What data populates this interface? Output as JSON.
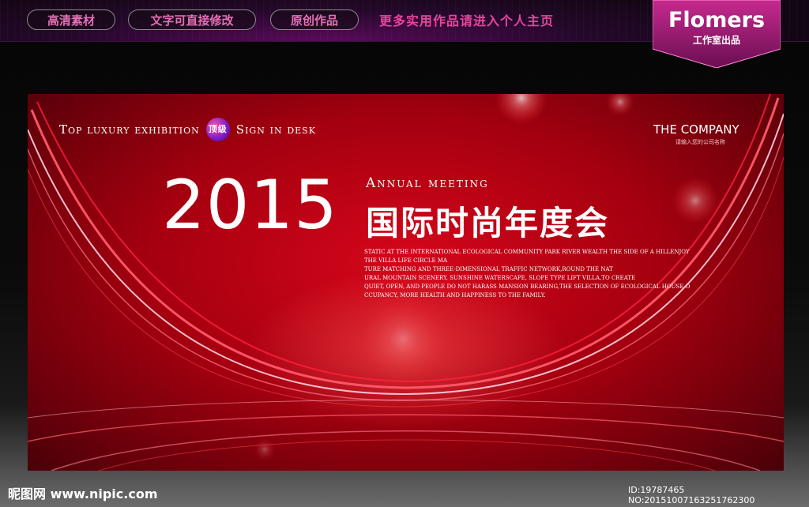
{
  "topbar": {
    "tags": [
      "高清素材",
      "文字可直接修改",
      "原创作品"
    ],
    "promo": "更多实用作品请进入个人主页"
  },
  "brand": {
    "name": "Flomers",
    "sub": "工作室出品"
  },
  "board": {
    "tagline_pre": "Top luxury exhibition",
    "badge": "顶级",
    "tagline_post": "Sign in desk",
    "company": "THE COMPANY",
    "company_sub": "请输入您的公司名称",
    "year": "2015",
    "annual": "Annual meeting",
    "title_zh": "国际时尚年度会",
    "body_lines": [
      "STATIC AT THE INTERNATIONAL ECOLOGICAL COMMUNITY PARK RIVER WEALTH THE SIDE OF A HILLENJOY",
      "THE VILLA LIFE CIRCLE MA",
      "TURE MATCHING AND THREE-DIMENSIONAL TRAFFIC NETWORK,ROUND THE NAT",
      "URAL MOUNTAIN SCENERY, SUNSHINE WATERSCAPE, SLOPE TYPE LIFT VILLA,TO CREATE",
      "QUIET, OPEN, AND PEOPLE DO NOT HARASS MANSION BEARING,THE SELECTION OF ECOLOGICAL HOUSE O",
      "CCUPANCY, MORE HEALTH AND HAPPINESS TO THE FAMILY."
    ]
  },
  "footer": {
    "site": "昵图网 www.nipic.com",
    "id_text": "ID:19787465 NO:20151007163251762300"
  },
  "colors": {
    "accent_pink": "#e4479c",
    "board_red": "#c8001a"
  }
}
